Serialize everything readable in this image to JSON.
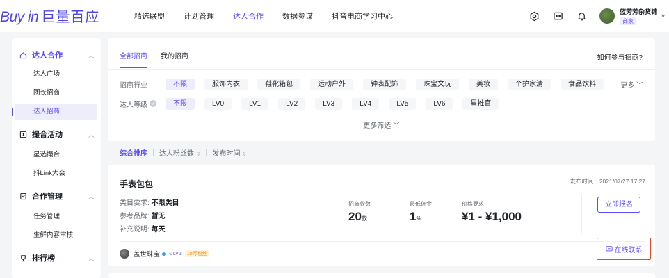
{
  "logo": {
    "text": "Buy in",
    "cn": "巨量百应"
  },
  "nav": [
    "精选联盟",
    "计划管理",
    "达人合作",
    "数据参谋",
    "抖音电商学习中心"
  ],
  "nav_active": "达人合作",
  "user": {
    "name": "蓝芳芳杂货铺",
    "role": "商家"
  },
  "sidebar": {
    "groups": [
      {
        "label": "达人合作",
        "active": true,
        "items": [
          {
            "label": "达人广场",
            "active": false
          },
          {
            "label": "团长招商",
            "active": false
          },
          {
            "label": "达人招商",
            "active": true
          }
        ]
      },
      {
        "label": "撮合活动",
        "active": false,
        "items": [
          {
            "label": "星选撮合",
            "active": false
          },
          {
            "label": "抖Link大会",
            "active": false
          }
        ]
      },
      {
        "label": "合作管理",
        "active": false,
        "items": [
          {
            "label": "任务管理",
            "active": false
          },
          {
            "label": "生鲜内容审核",
            "active": false
          }
        ]
      },
      {
        "label": "排行榜",
        "active": false,
        "items": []
      }
    ]
  },
  "tabs": {
    "all": "全部招商",
    "mine": "我的招商"
  },
  "howto": "如何参与招商?",
  "filters": {
    "industry_label": "招商行业",
    "industry": [
      "不限",
      "服饰内衣",
      "鞋靴箱包",
      "运动户外",
      "钟表配饰",
      "珠宝文玩",
      "美妆",
      "个护家清",
      "食品饮料"
    ],
    "more": "更多",
    "level_label": "达人等级",
    "level": [
      "不限",
      "LV0",
      "LV1",
      "LV2",
      "LV3",
      "LV4",
      "LV5",
      "LV6",
      "星推官"
    ],
    "more_filters": "更多筛选"
  },
  "sort": {
    "default": "综合排序",
    "fans": "达人粉丝数",
    "time": "发布时间"
  },
  "item": {
    "title": "手表包包",
    "publish_time": "发布时间：2021/07/27 17:27",
    "category_label": "类目要求:",
    "category_value": "不限类目",
    "brand_label": "参考品牌:",
    "brand_value": "暂无",
    "note_label": "补充说明:",
    "note_value": "每天",
    "count_label": "招商款数",
    "count_value": "20",
    "count_unit": "款",
    "commission_label": "最低佣金",
    "commission_value": "1",
    "commission_unit": "%",
    "price_label": "价格要求",
    "price_value": "¥1 - ¥1,000",
    "apply_button": "立即报名",
    "seller_name": "盖世珠宝",
    "seller_level": "LV2",
    "seller_fans": "10万粉丝",
    "contact_button": "在线联系"
  }
}
